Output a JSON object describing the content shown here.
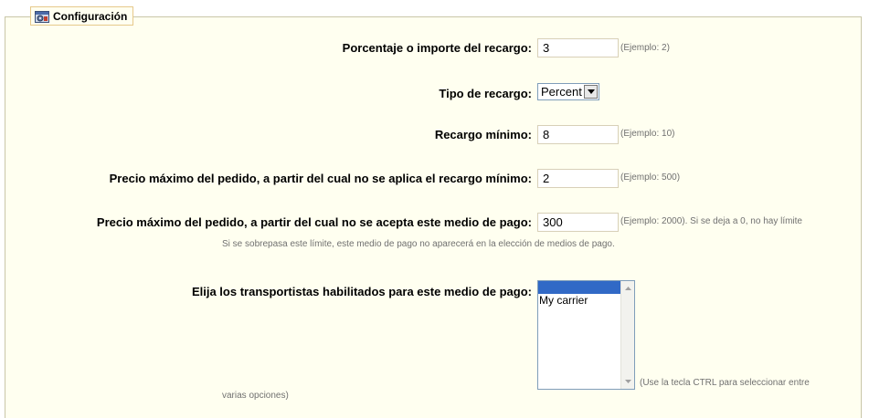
{
  "fieldset": {
    "legend": "Configuración",
    "legend_icon": "settings-icon"
  },
  "form": {
    "surcharge": {
      "label": "Porcentaje o importe del recargo:",
      "value": "3",
      "hint": "(Ejemplo: 2)"
    },
    "surcharge_type": {
      "label": "Tipo de recargo:",
      "selected": "Percent"
    },
    "min_surcharge": {
      "label": "Recargo mínimo:",
      "value": "8",
      "hint": "(Ejemplo: 10)"
    },
    "max_order_min": {
      "label": "Precio máximo del pedido, a partir del cual no se aplica el recargo mínimo:",
      "value": "2",
      "hint": "(Ejemplo: 500)"
    },
    "max_order_accept": {
      "label": "Precio máximo del pedido, a partir del cual no se acepta este medio de pago:",
      "value": "300",
      "hint": "(Ejemplo: 2000). Si se deja a 0, no hay límite",
      "note": "Si se sobrepasa este límite, este medio de pago no aparecerá en la elección de medios de pago."
    },
    "carriers": {
      "label": "Elija los transportistas habilitados para este medio de pago:",
      "items": [
        "",
        "My carrier"
      ],
      "hint_line1": "(Use la tecla CTRL para seleccionar entre",
      "hint_line2": "varias opciones)"
    }
  },
  "colors": {
    "panel_bg": "#fffff0",
    "legend_border": "#e6c98b",
    "selection": "#3169c6"
  }
}
